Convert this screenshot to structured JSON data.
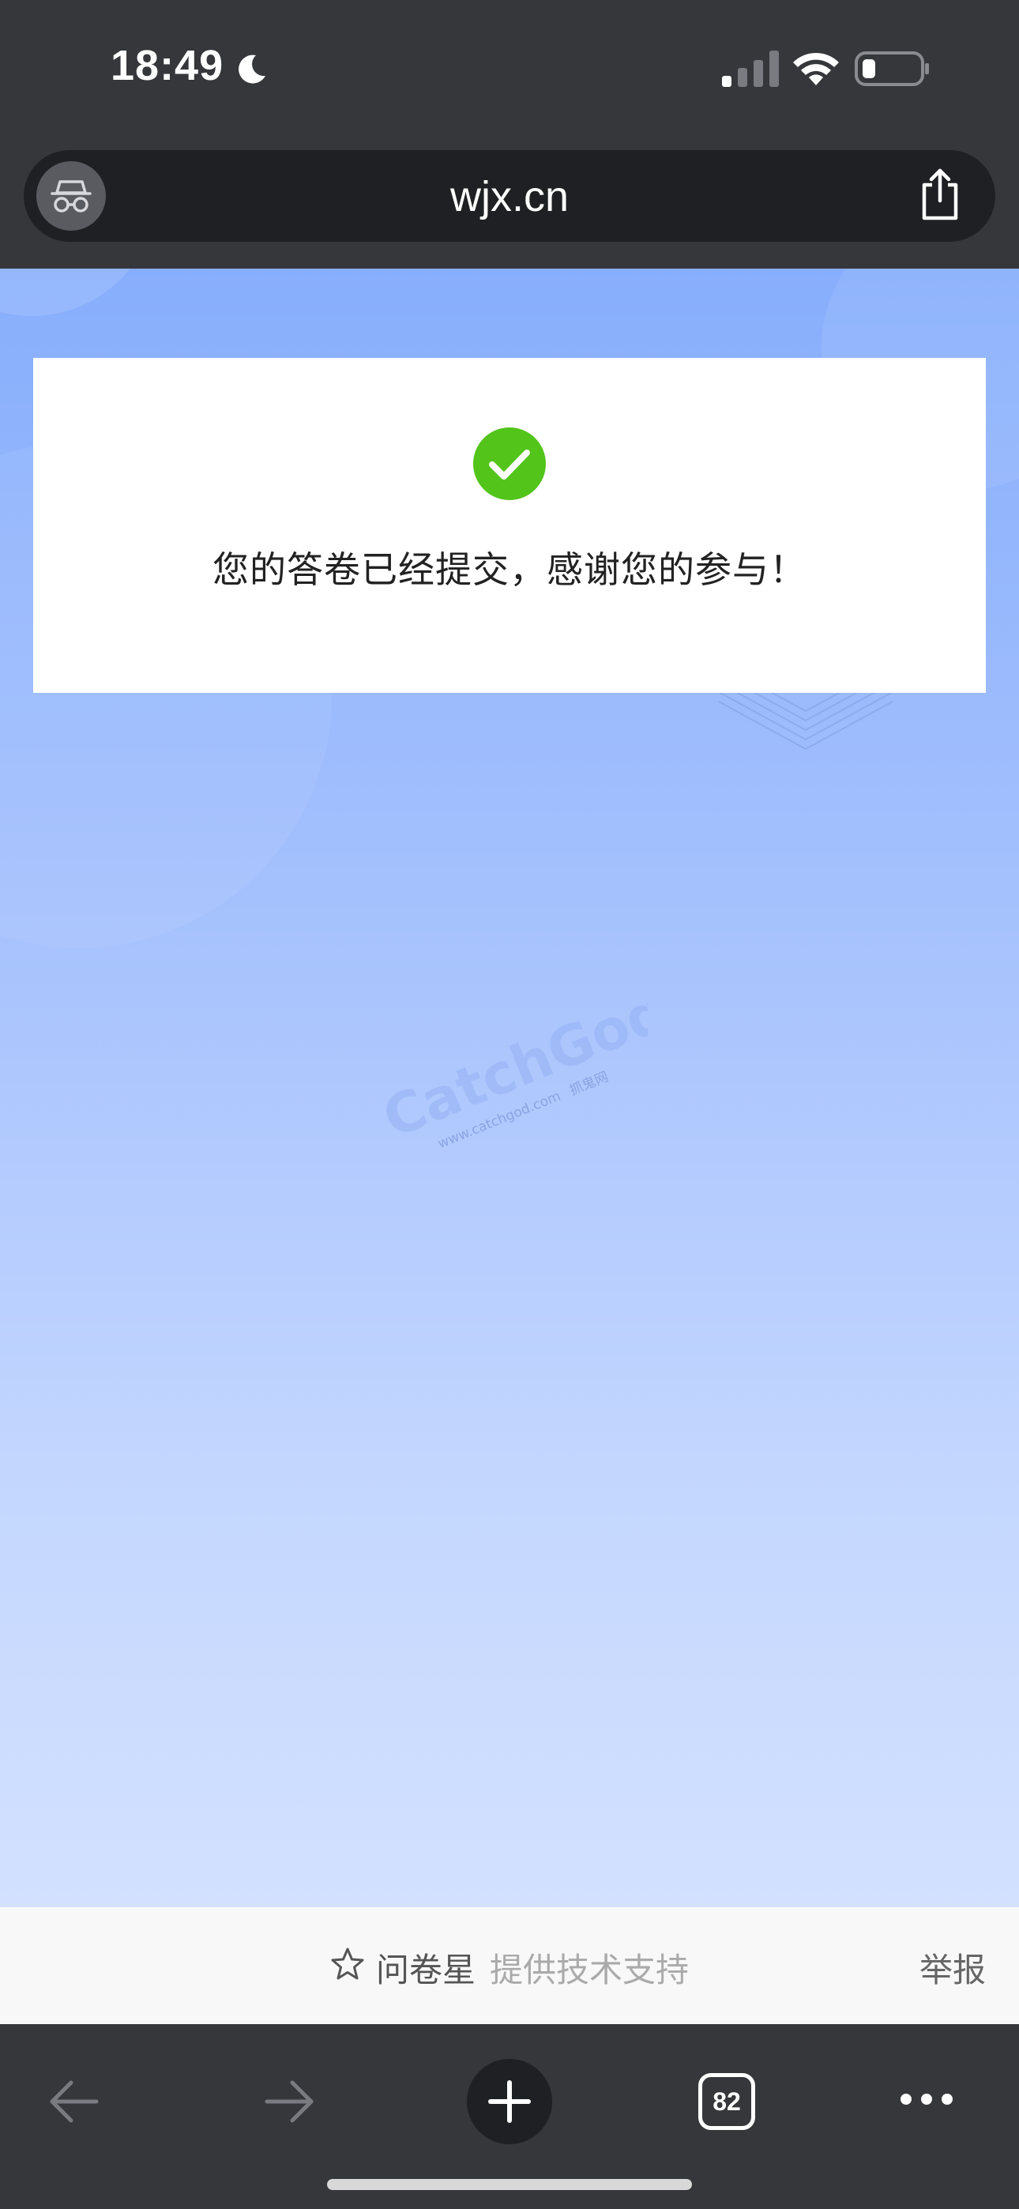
{
  "status_bar": {
    "time": "18:49",
    "icons": [
      "moon-icon",
      "signal-icon",
      "wifi-icon",
      "battery-icon"
    ]
  },
  "address_bar": {
    "url": "wjx.cn",
    "icons": [
      "incognito-icon",
      "share-icon"
    ]
  },
  "card": {
    "message": "您的答卷已经提交，感谢您的参与！",
    "icon": "check-circle-icon",
    "success_color": "#52c41a"
  },
  "watermark": {
    "brand": "CatchGod",
    "url": "www.catchgod.com",
    "cn": "抓鬼网"
  },
  "footer": {
    "brand": "问卷星",
    "support": "提供技术支持",
    "report": "举报",
    "icon": "star-icon"
  },
  "toolbar": {
    "tab_count": "82",
    "icons": [
      "back-arrow-icon",
      "forward-arrow-icon",
      "plus-icon",
      "tabs-icon",
      "more-icon"
    ]
  },
  "colors": {
    "chrome_bg": "#36373b",
    "address_bg": "#1f2023",
    "page_gradient_top": "#87aefc",
    "page_gradient_bottom": "#d3e1ff"
  }
}
